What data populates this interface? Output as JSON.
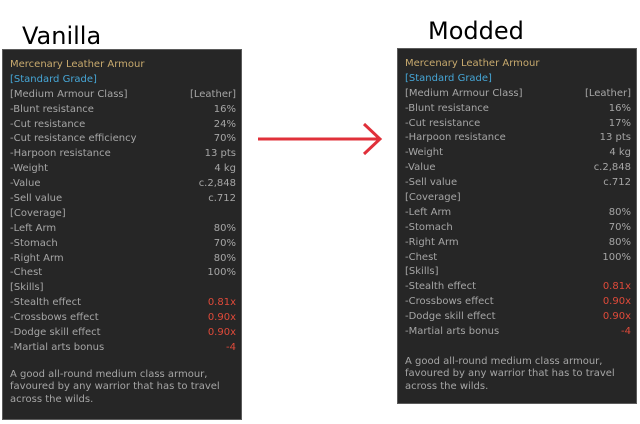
{
  "labels": {
    "vanilla": "Vanilla",
    "modded": "Modded"
  },
  "colors": {
    "panel_bg": "#262626",
    "title": "#c8aa6e",
    "grade": "#46a6d6",
    "negative": "#e04a3a",
    "arrow": "#e0303a"
  },
  "vanilla": {
    "title": "Mercenary Leather Armour",
    "grade": "[Standard Grade]",
    "rows": [
      {
        "label": "[Medium Armour Class]",
        "value": "[Leather]",
        "neg": false
      },
      {
        "label": "-Blunt resistance",
        "value": "16%",
        "neg": false
      },
      {
        "label": "-Cut resistance",
        "value": "24%",
        "neg": false
      },
      {
        "label": "-Cut resistance efficiency",
        "value": "70%",
        "neg": false
      },
      {
        "label": "-Harpoon resistance",
        "value": "13 pts",
        "neg": false
      },
      {
        "label": "-Weight",
        "value": "4 kg",
        "neg": false
      },
      {
        "label": "-Value",
        "value": "c.2,848",
        "neg": false
      },
      {
        "label": "-Sell value",
        "value": "c.712",
        "neg": false
      },
      {
        "label": "[Coverage]",
        "value": "",
        "neg": false
      },
      {
        "label": "-Left Arm",
        "value": "80%",
        "neg": false
      },
      {
        "label": "-Stomach",
        "value": "70%",
        "neg": false
      },
      {
        "label": "-Right Arm",
        "value": "80%",
        "neg": false
      },
      {
        "label": "-Chest",
        "value": "100%",
        "neg": false
      },
      {
        "label": "[Skills]",
        "value": "",
        "neg": false
      },
      {
        "label": "-Stealth effect",
        "value": "0.81x",
        "neg": true
      },
      {
        "label": "-Crossbows effect",
        "value": "0.90x",
        "neg": true
      },
      {
        "label": "-Dodge skill effect",
        "value": "0.90x",
        "neg": true
      },
      {
        "label": "-Martial arts bonus",
        "value": "-4",
        "neg": true
      }
    ],
    "description": "A good all-round medium class armour, favoured by any warrior that has to travel across the wilds."
  },
  "modded": {
    "title": "Mercenary Leather Armour",
    "grade": "[Standard Grade]",
    "rows": [
      {
        "label": "[Medium Armour Class]",
        "value": "[Leather]",
        "neg": false
      },
      {
        "label": "-Blunt resistance",
        "value": "16%",
        "neg": false
      },
      {
        "label": "-Cut resistance",
        "value": "17%",
        "neg": false
      },
      {
        "label": "-Harpoon resistance",
        "value": "13 pts",
        "neg": false
      },
      {
        "label": "-Weight",
        "value": "4 kg",
        "neg": false
      },
      {
        "label": "-Value",
        "value": "c.2,848",
        "neg": false
      },
      {
        "label": "-Sell value",
        "value": "c.712",
        "neg": false
      },
      {
        "label": "[Coverage]",
        "value": "",
        "neg": false
      },
      {
        "label": "-Left Arm",
        "value": "80%",
        "neg": false
      },
      {
        "label": "-Stomach",
        "value": "70%",
        "neg": false
      },
      {
        "label": "-Right Arm",
        "value": "80%",
        "neg": false
      },
      {
        "label": "-Chest",
        "value": "100%",
        "neg": false
      },
      {
        "label": "[Skills]",
        "value": "",
        "neg": false
      },
      {
        "label": "-Stealth effect",
        "value": "0.81x",
        "neg": true
      },
      {
        "label": "-Crossbows effect",
        "value": "0.90x",
        "neg": true
      },
      {
        "label": "-Dodge skill effect",
        "value": "0.90x",
        "neg": true
      },
      {
        "label": "-Martial arts bonus",
        "value": "-4",
        "neg": true
      }
    ],
    "description": "A good all-round medium class armour, favoured by any warrior that has to travel across the wilds."
  }
}
